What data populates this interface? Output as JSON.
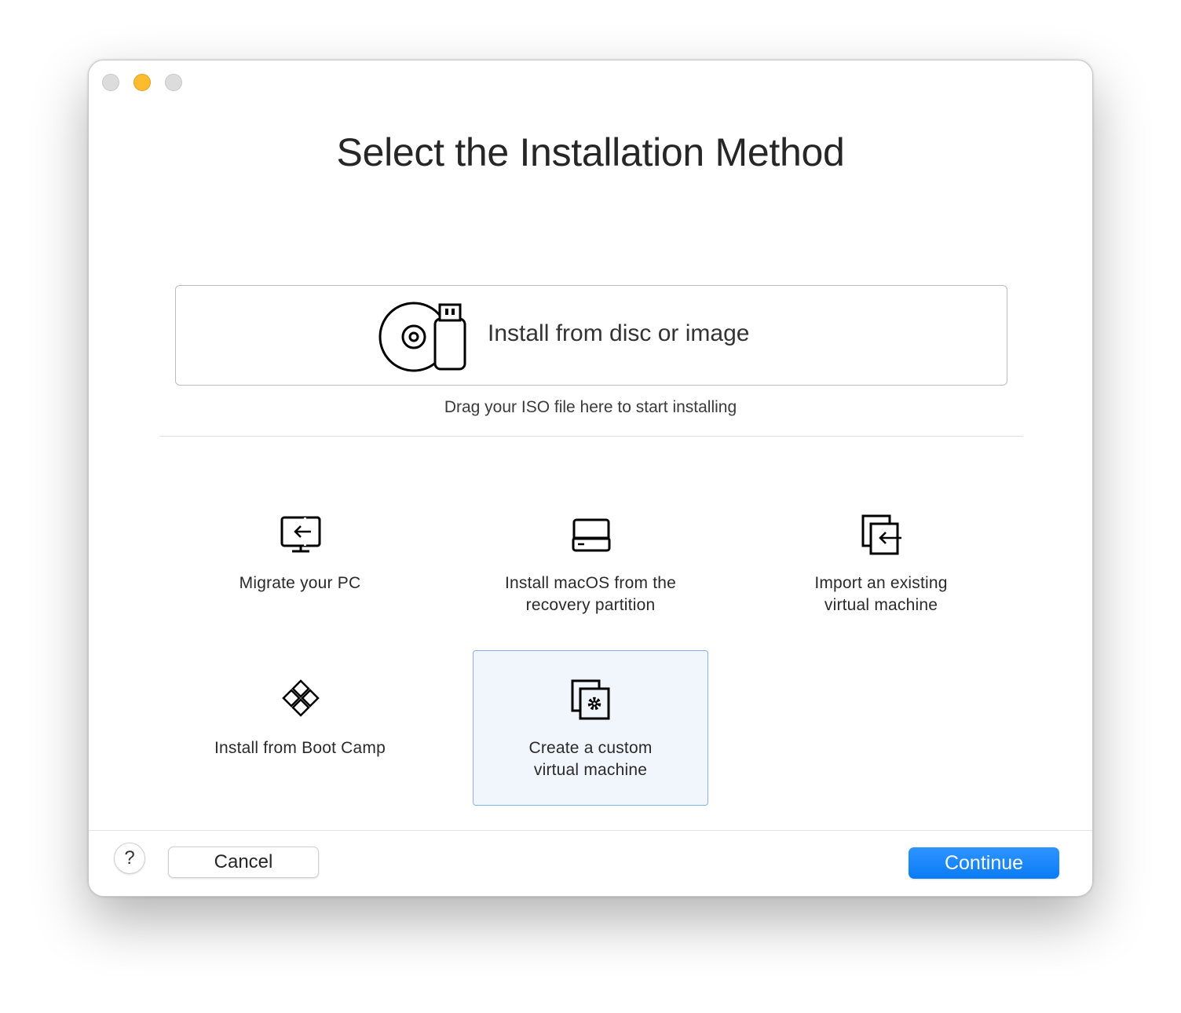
{
  "window": {
    "controls": [
      "close",
      "minimize",
      "zoom"
    ]
  },
  "header": {
    "title": "Select the Installation Method"
  },
  "drop_zone": {
    "label": "Install from disc or image",
    "hint": "Drag your ISO file here to start installing",
    "icon": "disc-usb-icon"
  },
  "options": [
    {
      "label": "Migrate your PC",
      "icon": "migrate-pc-icon",
      "selected": false
    },
    {
      "label": "Install macOS from the\nrecovery partition",
      "icon": "disk-drive-icon",
      "selected": false
    },
    {
      "label": "Import an existing\nvirtual machine",
      "icon": "import-vm-icon",
      "selected": false
    },
    {
      "label": "Install from Boot Camp",
      "icon": "boot-camp-icon",
      "selected": false
    },
    {
      "label": "Create a custom\nvirtual machine",
      "icon": "custom-vm-icon",
      "selected": true
    }
  ],
  "footer": {
    "help_label": "?",
    "cancel_label": "Cancel",
    "continue_label": "Continue"
  },
  "colors": {
    "accent": "#0a7cf6",
    "selected_bg": "#f1f6fd",
    "selected_border": "#8ab3e6",
    "minimize": "#fdbc2e"
  }
}
